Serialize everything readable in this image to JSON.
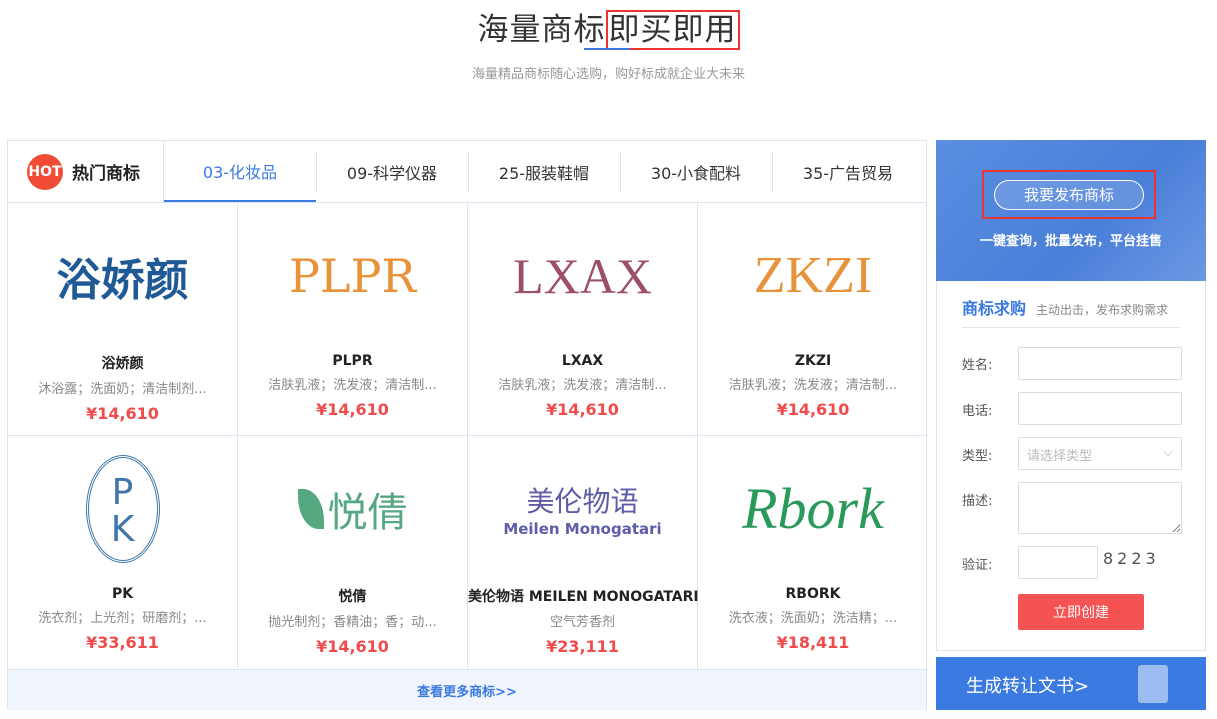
{
  "header": {
    "title_a": "海量商标",
    "title_b": "即买即用",
    "subtitle": "海量精品商标随心选购，购好标成就企业大未来"
  },
  "hot": {
    "badge": "HOT",
    "label": "热门商标"
  },
  "tabs": [
    {
      "label": "03-化妆品",
      "active": true
    },
    {
      "label": "09-科学仪器"
    },
    {
      "label": "25-服装鞋帽"
    },
    {
      "label": "30-小食配料"
    },
    {
      "label": "35-广告贸易"
    }
  ],
  "items": [
    {
      "logo": "浴娇颜",
      "name": "浴娇颜",
      "desc": "沐浴露；洗面奶；清洁制剂...",
      "price": "¥14,610"
    },
    {
      "logo": "PLPR",
      "name": "PLPR",
      "desc": "洁肤乳液；洗发液；清洁制...",
      "price": "¥14,610"
    },
    {
      "logo": "LXAX",
      "name": "LXAX",
      "desc": "洁肤乳液；洗发液；清洁制...",
      "price": "¥14,610"
    },
    {
      "logo": "ZKZI",
      "name": "ZKZI",
      "desc": "洁肤乳液；洗发液；清洁制...",
      "price": "¥14,610"
    },
    {
      "logo": "PK",
      "name": "PK",
      "desc": "洗衣剂；上光剂；研磨剂；...",
      "price": "¥33,611"
    },
    {
      "logo": "悦倩",
      "name": "悦倩",
      "desc": "抛光制剂；香精油；香；动...",
      "price": "¥14,610"
    },
    {
      "logo": "美伦物语",
      "logo_sub": "Meilen Monogatari",
      "name": "美伦物语 MEILEN MONOGATARI",
      "desc": "空气芳香剂",
      "price": "¥23,111"
    },
    {
      "logo": "Rbork",
      "name": "RBORK",
      "desc": "洗衣液；洗面奶；洗洁精；...",
      "price": "¥18,411"
    }
  ],
  "more": "查看更多商标>>",
  "banner": {
    "button": "我要发布商标",
    "sub": "一键查询，批量发布，平台挂售"
  },
  "form": {
    "title": "商标求购",
    "subtitle": "主动出击，发布求购需求",
    "name_label": "姓名:",
    "phone_label": "电话:",
    "type_label": "类型:",
    "type_placeholder": "请选择类型",
    "desc_label": "描述:",
    "verify_label": "验证:",
    "captcha": "8223",
    "submit": "立即创建"
  },
  "gen": {
    "label": "生成转让文书>"
  }
}
